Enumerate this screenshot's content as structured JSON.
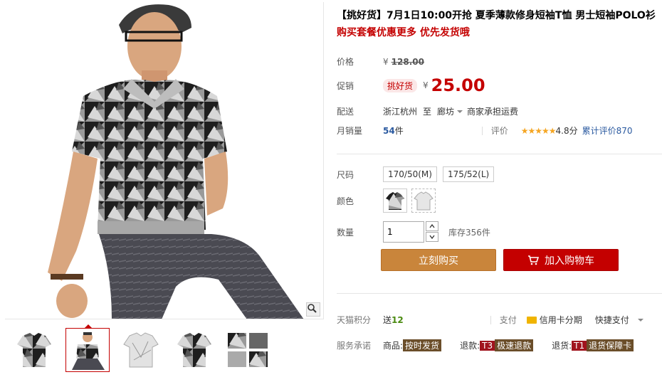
{
  "product": {
    "title": "【挑好货】7月1日10:00开抢 夏季薄款修身短袖T恤 男士短袖POLO衫",
    "subtitle": "购买套餐优惠更多 优先发货哦"
  },
  "price": {
    "label": "价格",
    "currency": "¥",
    "original": "128.00"
  },
  "promo": {
    "label": "促销",
    "tag": "挑好货",
    "currency": "¥",
    "price": "25.00"
  },
  "delivery": {
    "label": "配送",
    "from": "浙江杭州",
    "to_word": "至",
    "destination": "廊坊",
    "shipping_note": "商家承担运费"
  },
  "sales": {
    "label": "月销量",
    "count": "54",
    "unit": "件",
    "rating_label": "评价",
    "stars": "★★★★★",
    "score": "4.8分",
    "reviews": "累计评价870"
  },
  "size": {
    "label": "尺码",
    "options": [
      "170/50(M)",
      "175/52(L)"
    ]
  },
  "color": {
    "label": "颜色",
    "swatches": [
      "black-pattern-shirt",
      "white-pattern-shirt"
    ]
  },
  "quantity": {
    "label": "数量",
    "value": "1",
    "stock": "库存356件"
  },
  "actions": {
    "buy_now": "立刻购买",
    "add_cart": "加入购物车"
  },
  "points": {
    "label": "天猫积分",
    "prefix": "送",
    "amount": "12"
  },
  "payment": {
    "label": "支付",
    "credit": "信用卡分期",
    "express": "快捷支付"
  },
  "service": {
    "label": "服务承诺",
    "item1_prefix": "商品:",
    "item1_tag": "按时发货",
    "item2_prefix": "退款:",
    "item2_badge": "T3",
    "item2_tag": "极速退款",
    "item3_prefix": "退货:",
    "item3_badge": "T1",
    "item3_tag": "退货保障卡"
  },
  "colors": {
    "accent_red": "#c40000",
    "buy_orange": "#c9853b"
  }
}
